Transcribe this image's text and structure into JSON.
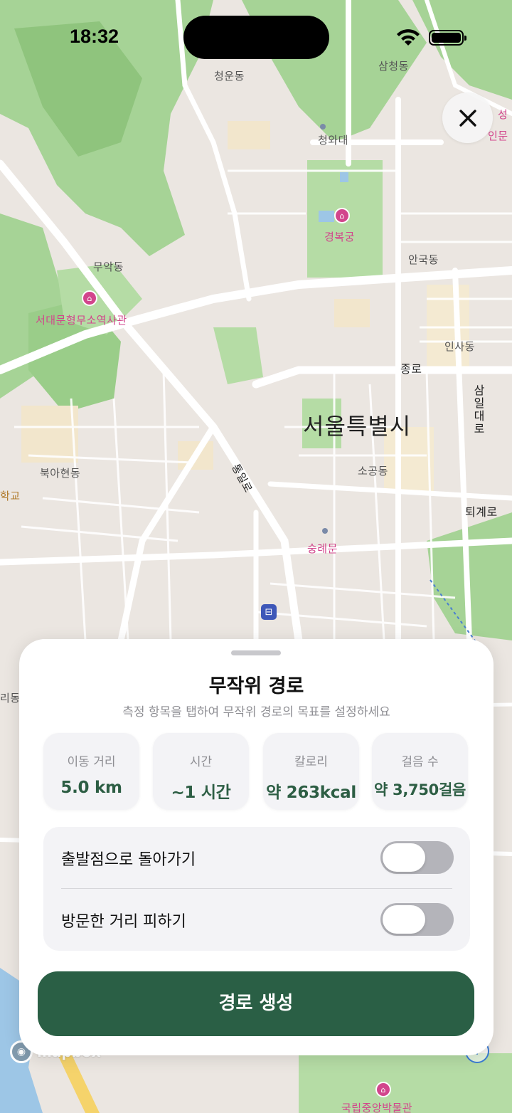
{
  "status_bar": {
    "time": "18:32"
  },
  "map": {
    "labels": {
      "cheongun": "청운동",
      "samcheong": "삼청동",
      "cheongwadae": "청와대",
      "gyeongbokgung": "경복궁",
      "anguk": "안국동",
      "muak": "무악동",
      "seodaemun_prison": "서대문형무소역사관",
      "insa": "인사동",
      "jongno": "종로",
      "samil": "삼일대로",
      "seoul": "서울특별시",
      "bugahyeon": "북아현동",
      "school": "학교",
      "sogong": "소공동",
      "toegye": "퇴계로",
      "sungnyemun": "숭례문",
      "tongil": "통일로",
      "edge_right1": "성",
      "edge_right2": "인문",
      "edge_left": "리동",
      "museum": "국립중앙박물관",
      "logo_text": "mapbox"
    }
  },
  "close_button": {
    "icon": "close-icon"
  },
  "sheet": {
    "title": "무작위 경로",
    "subtitle": "측정 항목을 탭하여 무작위 경로의 목표를 설정하세요",
    "metrics": [
      {
        "label": "이동 거리",
        "value": "5.0 km"
      },
      {
        "label": "시간",
        "value": "~1 시간"
      },
      {
        "label": "칼로리",
        "value": "약 263kcal"
      },
      {
        "label": "걸음 수",
        "value": "약 3,750걸음"
      }
    ],
    "toggles": [
      {
        "label": "출발점으로 돌아가기",
        "on": false
      },
      {
        "label": "방문한 거리 피하기",
        "on": false
      }
    ],
    "generate_label": "경로 생성"
  },
  "colors": {
    "accent": "#2a5f45",
    "metric_value": "#2d5e44",
    "park": "#9fd08e",
    "poi": "#d2458c"
  }
}
